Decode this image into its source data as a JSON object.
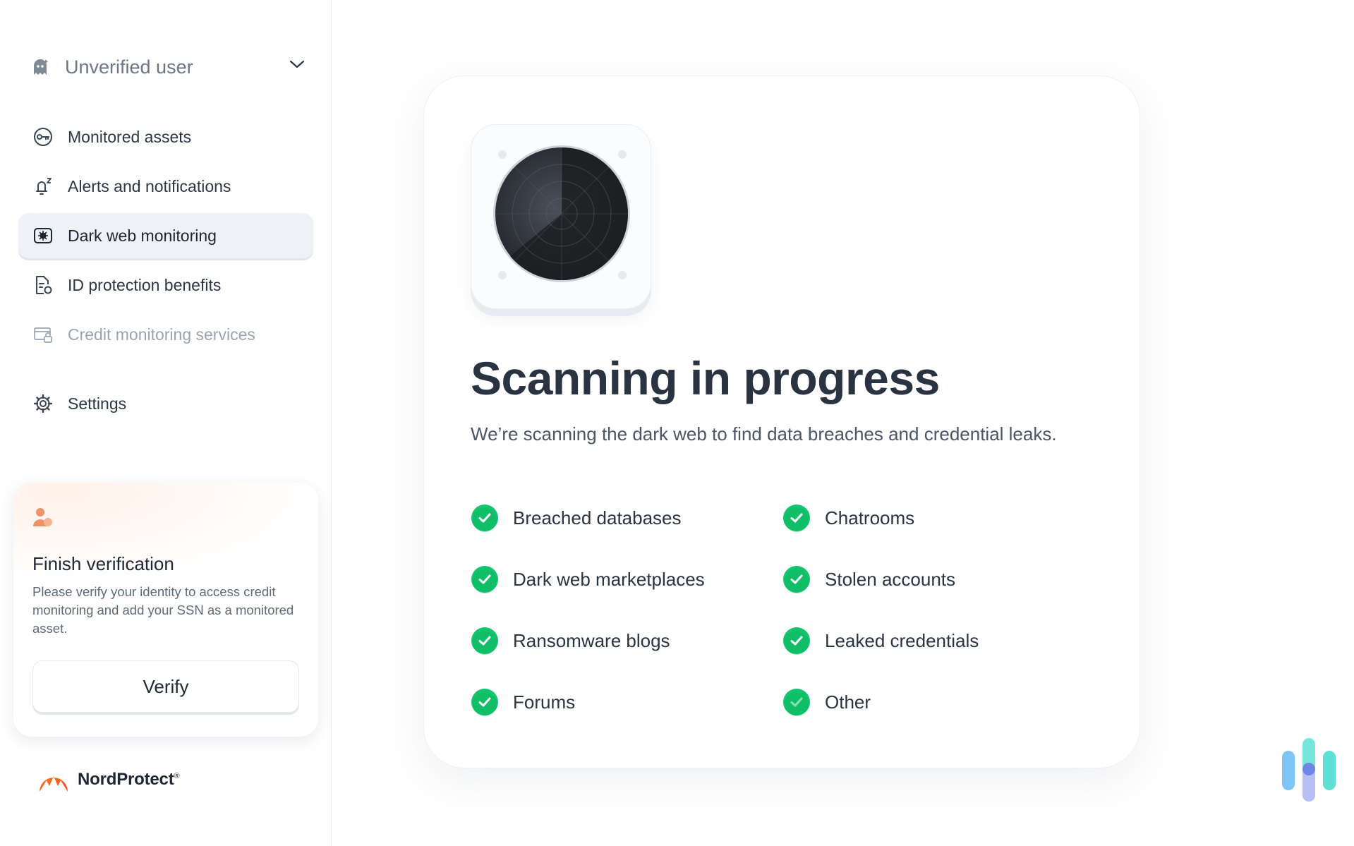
{
  "sidebar": {
    "user": {
      "name": "Unverified user",
      "icon": "ghost-icon"
    },
    "nav": [
      {
        "label": "Monitored assets",
        "icon": "key-icon",
        "state": "default"
      },
      {
        "label": "Alerts and notifications",
        "icon": "bell-icon",
        "state": "default"
      },
      {
        "label": "Dark web monitoring",
        "icon": "spider-web-icon",
        "state": "active"
      },
      {
        "label": "ID protection benefits",
        "icon": "document-shield-icon",
        "state": "default"
      },
      {
        "label": "Credit monitoring services",
        "icon": "credit-card-lock-icon",
        "state": "disabled"
      }
    ],
    "settings": {
      "label": "Settings",
      "icon": "gear-icon"
    },
    "verify_card": {
      "icon": "person-icon",
      "title": "Finish verification",
      "description": "Please verify your identity to access credit monitoring and add your SSN as a monitored asset.",
      "button_label": "Verify"
    },
    "brand": {
      "name": "NordProtect",
      "mark": "®"
    }
  },
  "main": {
    "title": "Scanning in progress",
    "subtitle": "We’re scanning the dark web to find data breaches and credential leaks.",
    "checks": [
      {
        "label": "Breached databases"
      },
      {
        "label": "Chatrooms"
      },
      {
        "label": "Dark web marketplaces"
      },
      {
        "label": "Stolen accounts"
      },
      {
        "label": "Ransomware blogs"
      },
      {
        "label": "Leaked credentials"
      },
      {
        "label": "Forums"
      },
      {
        "label": "Other"
      }
    ]
  },
  "colors": {
    "accent_green": "#12c46b",
    "active_bg": "#eef2f7",
    "brand_orange": "#ff5a1f",
    "text_primary": "#2a3342"
  }
}
